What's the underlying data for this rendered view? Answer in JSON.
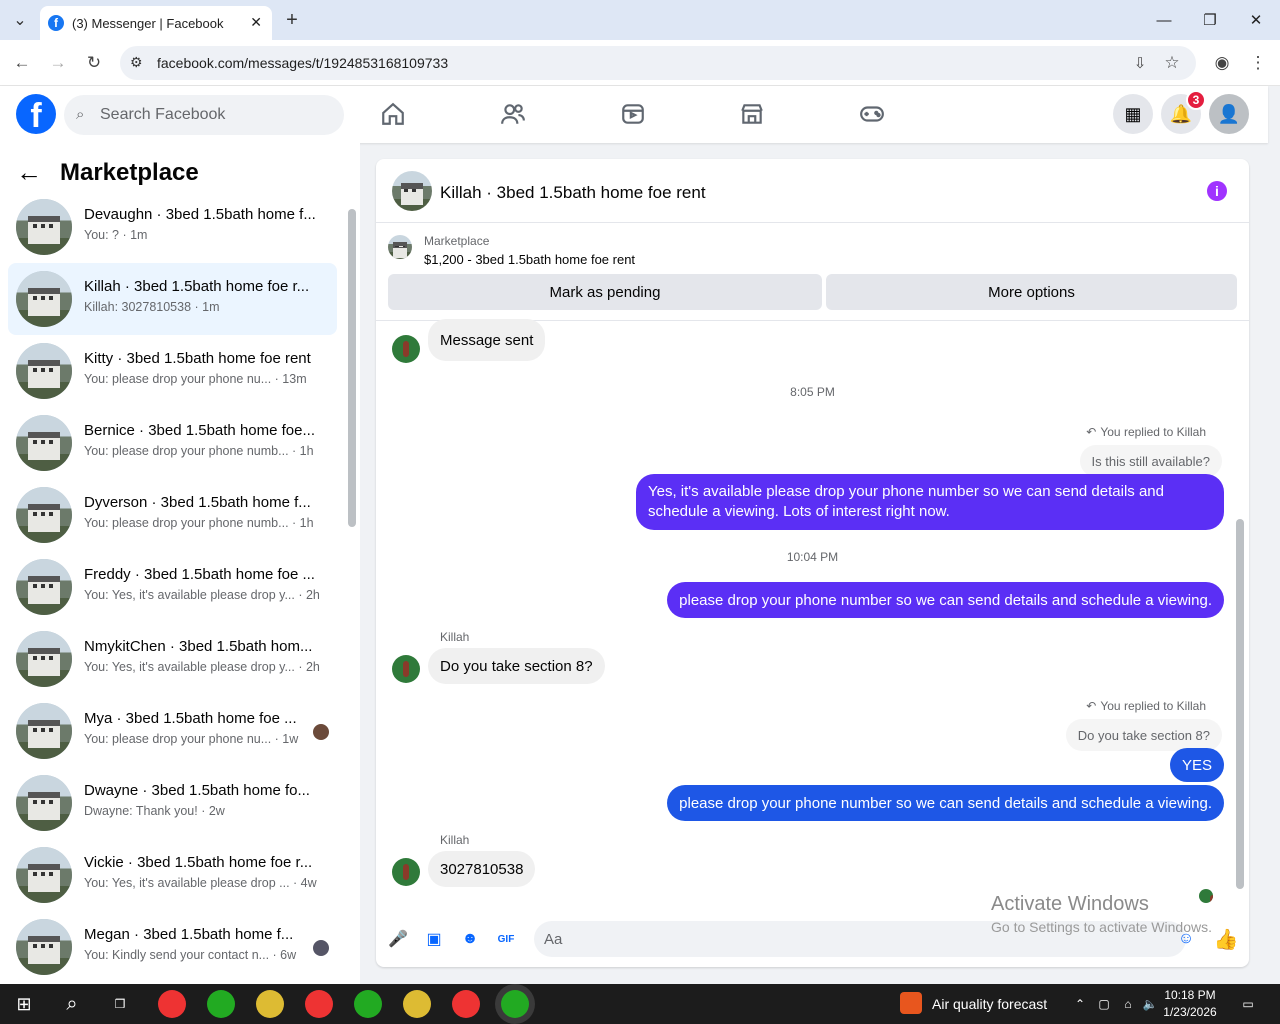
{
  "browser": {
    "tab_title": "(3) Messenger | Facebook",
    "url": "facebook.com/messages/t/1924853168109733"
  },
  "fb": {
    "search_placeholder": "Search Facebook",
    "notification_count": "3"
  },
  "sidebar": {
    "title": "Marketplace",
    "conversations": [
      {
        "title": "Devaughn · 3bed 1.5bath home f...",
        "preview": "You: ? · 1m",
        "active": false
      },
      {
        "title": "Killah · 3bed 1.5bath home foe r...",
        "preview": "Killah: 3027810538 · 1m",
        "active": true
      },
      {
        "title": "Kitty · 3bed 1.5bath home foe rent",
        "preview": "You: please drop your phone nu... · 13m",
        "active": false
      },
      {
        "title": "Bernice · 3bed 1.5bath home foe...",
        "preview": "You: please drop your phone numb... · 1h",
        "active": false
      },
      {
        "title": "Dyverson · 3bed 1.5bath home f...",
        "preview": "You: please drop your phone numb... · 1h",
        "active": false
      },
      {
        "title": "Freddy · 3bed 1.5bath home foe ...",
        "preview": "You: Yes, it's available please drop y... · 2h",
        "active": false
      },
      {
        "title": "NmykitChen · 3bed 1.5bath hom...",
        "preview": "You: Yes, it's available please drop y... · 2h",
        "active": false
      },
      {
        "title": "Mya · 3bed 1.5bath home foe ...",
        "preview": "You: please drop your phone nu... · 1w",
        "active": false
      },
      {
        "title": "Dwayne · 3bed 1.5bath home fo...",
        "preview": "Dwayne: Thank you! · 2w",
        "active": false
      },
      {
        "title": "Vickie · 3bed 1.5bath home foe r...",
        "preview": "You: Yes, it's available please drop ... · 4w",
        "active": false
      },
      {
        "title": "Megan · 3bed 1.5bath home f...",
        "preview": "You: Kindly send your contact n... · 6w",
        "active": false
      }
    ]
  },
  "chat": {
    "title": "Killah · 3bed 1.5bath home foe rent",
    "marketplace_label": "Marketplace",
    "listing": "$1,200 - 3bed 1.5bath home foe rent",
    "mark_pending": "Mark as pending",
    "more_options": "More options",
    "messages": {
      "m1": "Message sent",
      "ts1": "8:05 PM",
      "reply1": "You replied to Killah",
      "quote1": "Is this still available?",
      "m2a": "Yes, it's available please drop your phone number so we can send details and",
      "m2b": "schedule a viewing. Lots of interest right now.",
      "ts2": "10:04 PM",
      "m3": "please drop your phone number so we can send details and schedule a viewing.",
      "sender1": "Killah",
      "m4": "Do you take section 8?",
      "reply2": "You replied to Killah",
      "quote2": "Do you take section 8?",
      "m5": "YES",
      "m6": "please drop your phone number so we can send details and schedule a viewing.",
      "sender2": "Killah",
      "m7": "3027810538"
    },
    "input_placeholder": "Aa"
  },
  "watermark": {
    "line1": "Activate Windows",
    "line2": "Go to Settings to activate Windows."
  },
  "taskbar": {
    "weather": "Air quality forecast",
    "time": "10:18 PM",
    "date": "1/23/2026"
  }
}
